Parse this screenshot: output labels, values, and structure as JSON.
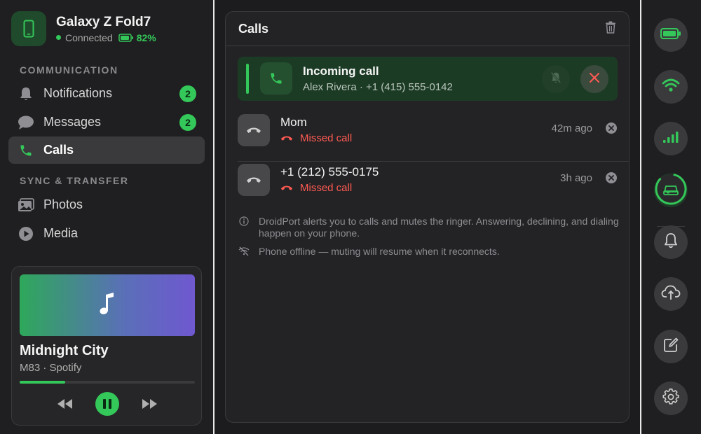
{
  "device": {
    "name": "Galaxy Z Fold7",
    "status": "Connected",
    "battery": "82%"
  },
  "sidebar": {
    "sections": [
      {
        "label": "COMMUNICATION"
      },
      {
        "label": "SYNC & TRANSFER"
      }
    ],
    "items": [
      {
        "label": "Notifications",
        "badge": "2",
        "icon": "bell-icon"
      },
      {
        "label": "Messages",
        "badge": "2",
        "icon": "chat-bubble-icon"
      },
      {
        "label": "Calls",
        "active": true,
        "icon": "phone-icon"
      },
      {
        "label": "Photos",
        "icon": "photos-icon"
      },
      {
        "label": "Media",
        "icon": "play-circle-icon"
      }
    ]
  },
  "media": {
    "title": "Midnight City",
    "subtitle": "M83 · Spotify",
    "progress": 0.26
  },
  "calls": {
    "title": "Calls",
    "incoming": {
      "title": "Incoming call",
      "subtitle": "Alex Rivera · +1 (415) 555-0142"
    },
    "list": [
      {
        "name": "Mom",
        "status": "Missed call",
        "time": "42m ago"
      },
      {
        "name": "+1 (212) 555-0175",
        "status": "Missed call",
        "time": "3h ago"
      }
    ],
    "notes": [
      {
        "text": "DroidPort alerts you to calls and mutes the ringer. Answering, declining, and dialing happen on your phone.",
        "icon": "info-icon"
      },
      {
        "text": "Phone offline — muting will resume when it reconnects.",
        "icon": "wifi-off-icon"
      }
    ]
  },
  "colors": {
    "accent": "#34c759",
    "missed": "#ff5a52"
  }
}
